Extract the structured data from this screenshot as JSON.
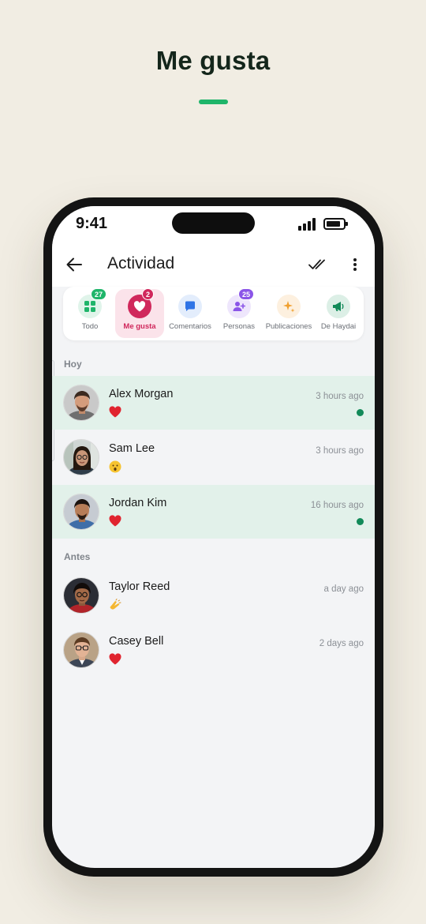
{
  "promo": {
    "title": "Me gusta"
  },
  "status_bar": {
    "time": "9:41"
  },
  "header": {
    "title": "Actividad"
  },
  "tabs": [
    {
      "label": "Todo",
      "badge": "27",
      "icon": "grid-icon",
      "badge_color": "#1fb56a",
      "active": false
    },
    {
      "label": "Me gusta",
      "badge": "2",
      "icon": "heart-icon",
      "badge_color": "#d0285c",
      "active": true
    },
    {
      "label": "Comentarios",
      "badge": "",
      "icon": "comment-icon",
      "active": false
    },
    {
      "label": "Personas",
      "badge": "25",
      "icon": "person-add-icon",
      "badge_color": "#8b55e8",
      "active": false
    },
    {
      "label": "Publicaciones",
      "badge": "",
      "icon": "sparkle-icon",
      "active": false
    },
    {
      "label": "De Haydai",
      "badge": "",
      "icon": "megaphone-icon",
      "active": false
    }
  ],
  "sections": {
    "today": "Hoy",
    "earlier": "Antes"
  },
  "notifications": [
    {
      "name": "Alex Morgan",
      "reaction": "heart-emoji",
      "time": "3 hours ago",
      "unread": true
    },
    {
      "name": "Sam Lee",
      "reaction": "surprised-face-emoji",
      "time": "3 hours ago",
      "unread": false
    },
    {
      "name": "Jordan Kim",
      "reaction": "heart-emoji",
      "time": "16 hours ago",
      "unread": true
    },
    {
      "name": "Taylor Reed",
      "reaction": "clapping-hands-emoji",
      "time": "a day ago",
      "unread": false
    },
    {
      "name": "Casey Bell",
      "reaction": "heart-emoji",
      "time": "2 days ago",
      "unread": false
    }
  ],
  "colors": {
    "accent_green": "#1fb56a",
    "like_pink": "#d0285c",
    "unread_row": "#e2f1ea",
    "unread_dot": "#128a59",
    "background": "#f1ede3"
  }
}
